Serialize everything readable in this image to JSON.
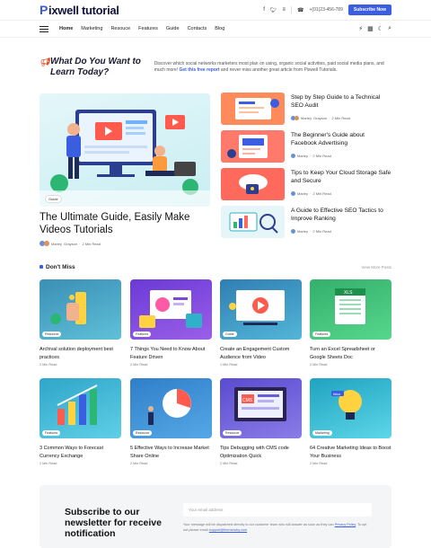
{
  "brand": {
    "logo_mark": "P",
    "logo_text": "ixwell tutorial"
  },
  "topbar": {
    "phone": "+(01)23-456-789",
    "subscribe": "Subscribe Now"
  },
  "nav": {
    "items": [
      "Home",
      "Marketing",
      "Resouce",
      "Features",
      "Guide",
      "Contacts",
      "Blog"
    ],
    "active": 0
  },
  "promo": {
    "heading": "What Do You Want to Learn Today?",
    "desc_1": "Discover which social networks marketers most plan on using, organic social activities, paid social media plans, and much more! ",
    "desc_link": "Get this free report",
    "desc_2": " and never miss another great article from Pixwell Tutorials."
  },
  "hero": {
    "tag": "Guide",
    "title": "The Ultimate Guide, Easily Make Videos Tutorials",
    "author": "Marley",
    "author2": "Grayson",
    "read": "2 Min Read"
  },
  "side": [
    {
      "title": "Step by Step Guide to a Technical SEO Audit",
      "author": "Marley",
      "author2": "Grayson",
      "read": "2 Min Read"
    },
    {
      "title": "The Beginner's Guide about Facebook Advertising",
      "author": "Marley",
      "read": "2 Min Read"
    },
    {
      "title": "Tips to Keep Your Cloud Storage Safe and Secure",
      "author": "Marley",
      "read": "2 Min Read"
    },
    {
      "title": "A Guide to Effective SEO Tactics to Improve Ranking",
      "author": "Marley",
      "read": "2 Min Read"
    }
  ],
  "dont_miss": {
    "title": "Don't Miss",
    "more": "View More Posts"
  },
  "cards": [
    {
      "tag": "Resource",
      "title": "Archival solution deployment best practices",
      "read": "2 Min Read",
      "bg": "#3a8fb5"
    },
    {
      "tag": "Features",
      "title": "7 Things You Need to Know About Feature Driven",
      "read": "2 Min Read",
      "bg": "#7b45d6"
    },
    {
      "tag": "Guide",
      "title": "Create an Engagement Custom Audience from Video",
      "read": "1 Min Read",
      "bg": "#2f7fb2"
    },
    {
      "tag": "Features",
      "title": "Turn an Excel Spreadsheet or Google Sheets Doc",
      "read": "2 Min Read",
      "bg": "#3bbf74"
    },
    {
      "tag": "Features",
      "title": "3 Common Ways to Forecast Currency Exchange",
      "read": "2 Min Read",
      "bg": "#2fa6c9"
    },
    {
      "tag": "Resource",
      "title": "5 Effective Ways to Increase Market Share Online",
      "read": "2 Min Read",
      "bg": "#3a86c9"
    },
    {
      "tag": "Resource",
      "title": "Tips Debugging with CMS code Optimization Quick",
      "read": "2 Min Read",
      "bg": "#6a5bd6"
    },
    {
      "tag": "Marketing",
      "title": "64 Creative Marketing Ideas to Boost Your Business",
      "read": "2 Min Read",
      "bg": "#2fb2c9"
    }
  ],
  "newsletter": {
    "heading": "Subscribe to our newsletter for receive notification",
    "placeholder": "Your email address",
    "fine_1": "Your message will be dispatched directly to our customer team who will answer as soon as they can ",
    "fine_link1": "Privacy Policy",
    "fine_2": ". To opt out please email ",
    "fine_link2": "support@themeruby.com"
  }
}
